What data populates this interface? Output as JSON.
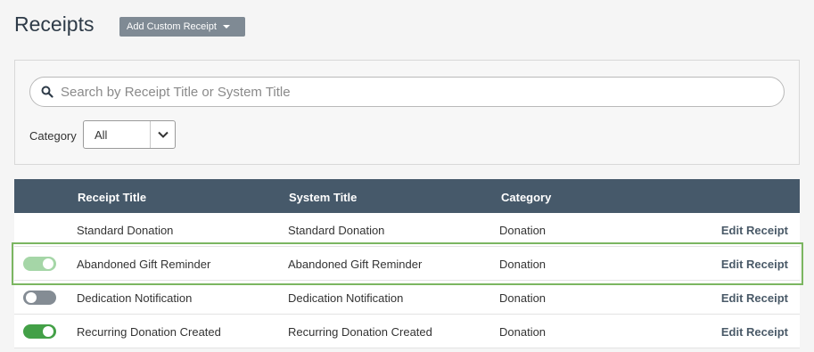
{
  "header": {
    "title": "Receipts",
    "add_button_label": "Add Custom Receipt"
  },
  "filters": {
    "search_placeholder": "Search by Receipt Title or System Title",
    "search_value": "",
    "category_label": "Category",
    "category_value": "All"
  },
  "table": {
    "columns": [
      "Receipt Title",
      "System Title",
      "Category"
    ],
    "rows": [
      {
        "receipt_title": "Standard Donation",
        "system_title": "Standard Donation",
        "category": "Donation",
        "action": "Edit Receipt",
        "toggle": "none"
      },
      {
        "receipt_title": "Abandoned Gift Reminder",
        "system_title": "Abandoned Gift Reminder",
        "category": "Donation",
        "action": "Edit Receipt",
        "toggle": "on-light"
      },
      {
        "receipt_title": "Dedication Notification",
        "system_title": "Dedication Notification",
        "category": "Donation",
        "action": "Edit Receipt",
        "toggle": "off"
      },
      {
        "receipt_title": "Recurring Donation Created",
        "system_title": "Recurring Donation Created",
        "category": "Donation",
        "action": "Edit Receipt",
        "toggle": "on"
      }
    ]
  },
  "colors": {
    "header_bg": "#46596a",
    "toggle_on": "#43a047",
    "toggle_on_light": "#a5d6a7",
    "toggle_off": "#848c94",
    "highlight": "#7bb661"
  }
}
